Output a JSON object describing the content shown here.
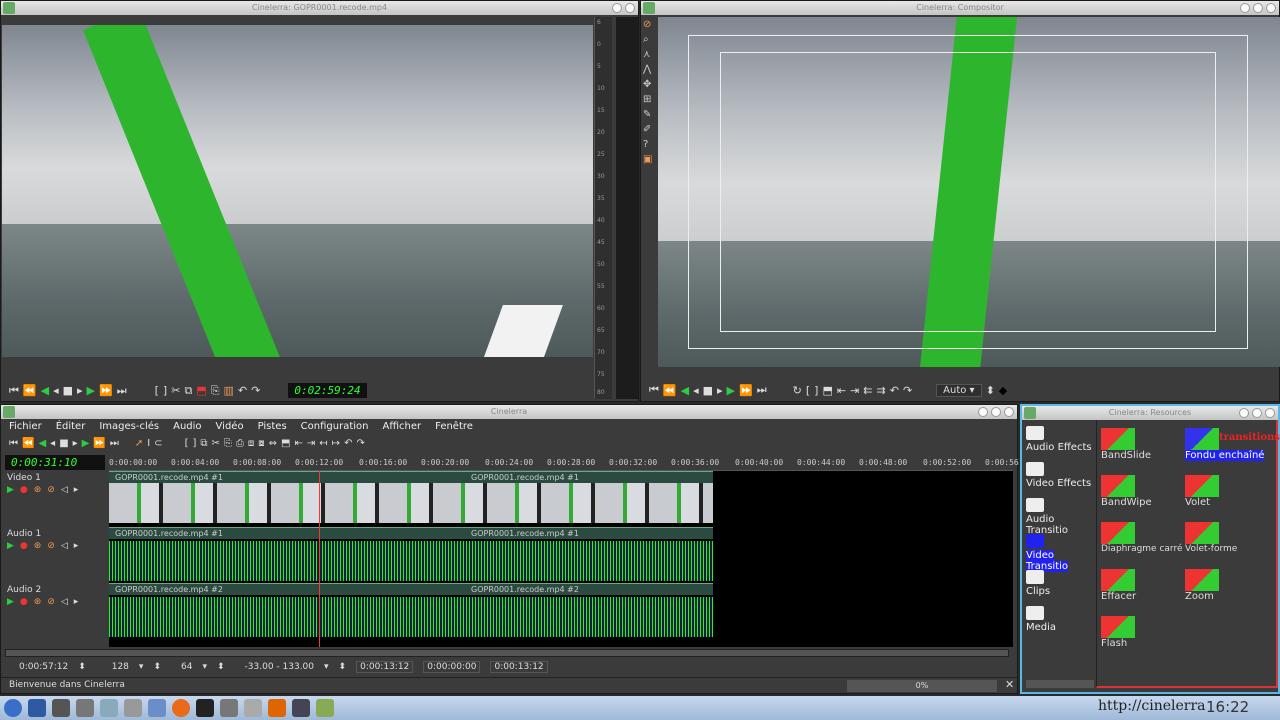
{
  "viewer": {
    "title": "Cinelerra: GOPR0001.recode.mp4",
    "timecode": "0:02:59:24",
    "ruler": [
      "6",
      "0",
      "5",
      "10",
      "15",
      "20",
      "25",
      "30",
      "35",
      "40",
      "45",
      "50",
      "55",
      "60",
      "65",
      "70",
      "75",
      "80"
    ]
  },
  "compositor": {
    "title": "Cinelerra: Compositor",
    "zoom": "Auto"
  },
  "main": {
    "title": "Cinelerra",
    "menu": [
      "Fichier",
      "Éditer",
      "Images-clés",
      "Audio",
      "Vidéo",
      "Pistes",
      "Configuration",
      "Afficher",
      "Fenêtre"
    ],
    "timecode": "0:00:31:10",
    "ruler": [
      "0:00:00:00",
      "0:00:04:00",
      "0:00:08:00",
      "0:00:12:00",
      "0:00:16:00",
      "0:00:20:00",
      "0:00:24:00",
      "0:00:28:00",
      "0:00:32:00",
      "0:00:36:00",
      "0:00:40:00",
      "0:00:44:00",
      "0:00:48:00",
      "0:00:52:00",
      "0:00:56"
    ],
    "tracks": [
      {
        "name": "Video 1",
        "clips": [
          "GOPR0001.recode.mp4 #1",
          "GOPR0001.recode.mp4 #1"
        ]
      },
      {
        "name": "Audio 1",
        "clips": [
          "GOPR0001.recode.mp4 #1",
          "GOPR0001.recode.mp4 #1"
        ]
      },
      {
        "name": "Audio 2",
        "clips": [
          "GOPR0001.recode.mp4 #2",
          "GOPR0001.recode.mp4 #2"
        ]
      }
    ],
    "bottom": {
      "duration": "0:00:57:12",
      "zoom1": "128",
      "zoom2": "64",
      "range": "-33.00 - 133.00",
      "sel_start": "0:00:13:12",
      "sel_len": "0:00:00:00",
      "sel_end": "0:00:13:12"
    },
    "status": "Bienvenue dans Cinelerra",
    "progress": "0%"
  },
  "resources": {
    "title": "Cinelerra: Resources",
    "folders": [
      "Audio Effects",
      "Video Effects",
      "Audio Transitio",
      "Video Transitio",
      "Clips",
      "Media"
    ],
    "items": [
      "BandSlide",
      "Fondu enchaîné",
      "BandWipe",
      "Volet",
      "Diaphragme carré",
      "Volet-forme",
      "Effacer",
      "Zoom",
      "Flash"
    ],
    "overlay": "transitions"
  },
  "taskbar": {
    "clock": "16:22",
    "watermark": "http://cinelerra"
  }
}
